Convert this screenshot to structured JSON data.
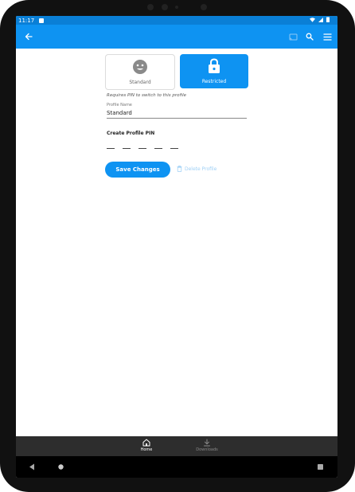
{
  "status_bar": {
    "time": "11:17"
  },
  "profile_types": [
    {
      "label": "Standard",
      "icon": "smiley-icon",
      "selected": false
    },
    {
      "label": "Restricted",
      "icon": "lock-icon",
      "selected": true
    }
  ],
  "pin_hint": "Requires PIN to switch to this profile",
  "profile_name": {
    "label": "Profile Name",
    "value": "Standard"
  },
  "pin": {
    "title": "Create Profile PIN"
  },
  "actions": {
    "save_label": "Save Changes",
    "delete_label": "Delete Profile"
  },
  "bottom_nav": [
    {
      "label": "Home",
      "icon": "home-icon",
      "active": true
    },
    {
      "label": "Downloads",
      "icon": "download-icon",
      "active": false
    }
  ],
  "colors": {
    "accent": "#0e93f2",
    "status_bar": "#0a7fd6",
    "bottom_nav": "#2d2d2d"
  }
}
